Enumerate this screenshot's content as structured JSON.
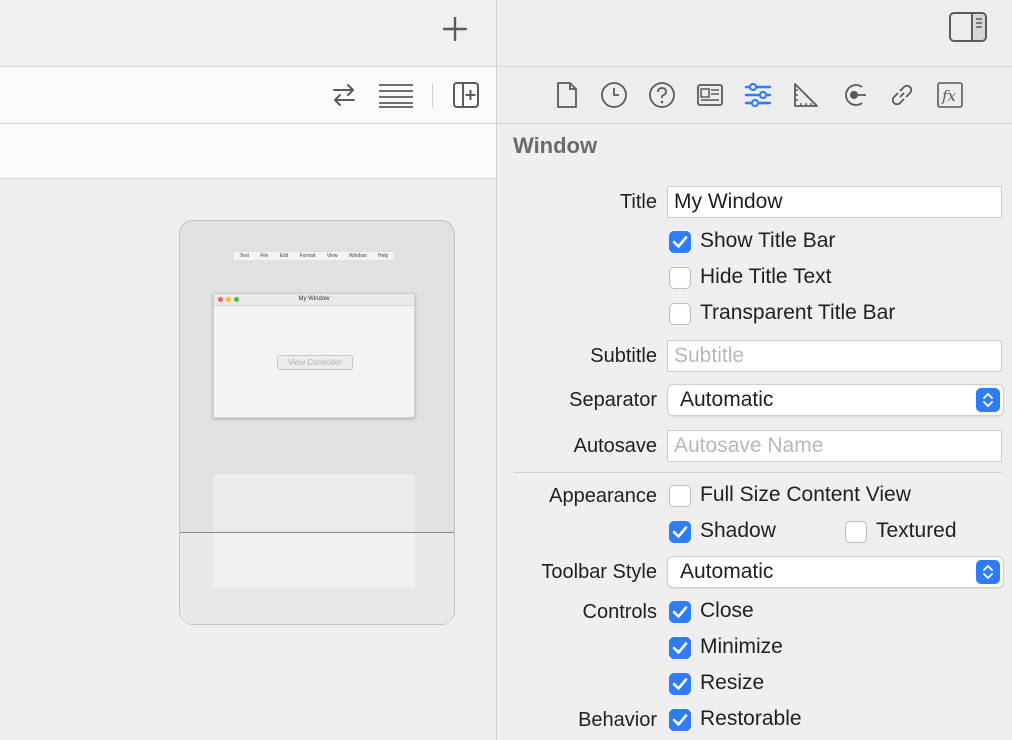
{
  "inspector": {
    "section_title": "Window",
    "title_label": "Title",
    "title_value": "My Window",
    "show_title_bar": {
      "label": "Show Title Bar",
      "checked": true
    },
    "hide_title_text": {
      "label": "Hide Title Text",
      "checked": false
    },
    "transparent_title_bar": {
      "label": "Transparent Title Bar",
      "checked": false
    },
    "subtitle_label": "Subtitle",
    "subtitle_placeholder": "Subtitle",
    "separator_label": "Separator",
    "separator_value": "Automatic",
    "autosave_label": "Autosave",
    "autosave_placeholder": "Autosave Name",
    "appearance_label": "Appearance",
    "full_size_content_view": {
      "label": "Full Size Content View",
      "checked": false
    },
    "shadow": {
      "label": "Shadow",
      "checked": true
    },
    "textured": {
      "label": "Textured",
      "checked": false
    },
    "toolbar_style_label": "Toolbar Style",
    "toolbar_style_value": "Automatic",
    "controls_label": "Controls",
    "close": {
      "label": "Close",
      "checked": true
    },
    "minimize": {
      "label": "Minimize",
      "checked": true
    },
    "resize": {
      "label": "Resize",
      "checked": true
    },
    "behavior_label": "Behavior",
    "restorable": {
      "label": "Restorable",
      "checked": true
    }
  },
  "inspector_tabs": [
    "file-icon",
    "history-icon",
    "help-icon",
    "identity-icon",
    "attributes-icon",
    "size-icon",
    "connections-icon",
    "bindings-icon",
    "effects-icon"
  ],
  "accent_color": "#2f7cf6",
  "mockup": {
    "menu_items": [
      "Test",
      "File",
      "Edit",
      "Format",
      "View",
      "Window",
      "Help"
    ],
    "window_title": "My Window",
    "content_label": "View Controller"
  }
}
